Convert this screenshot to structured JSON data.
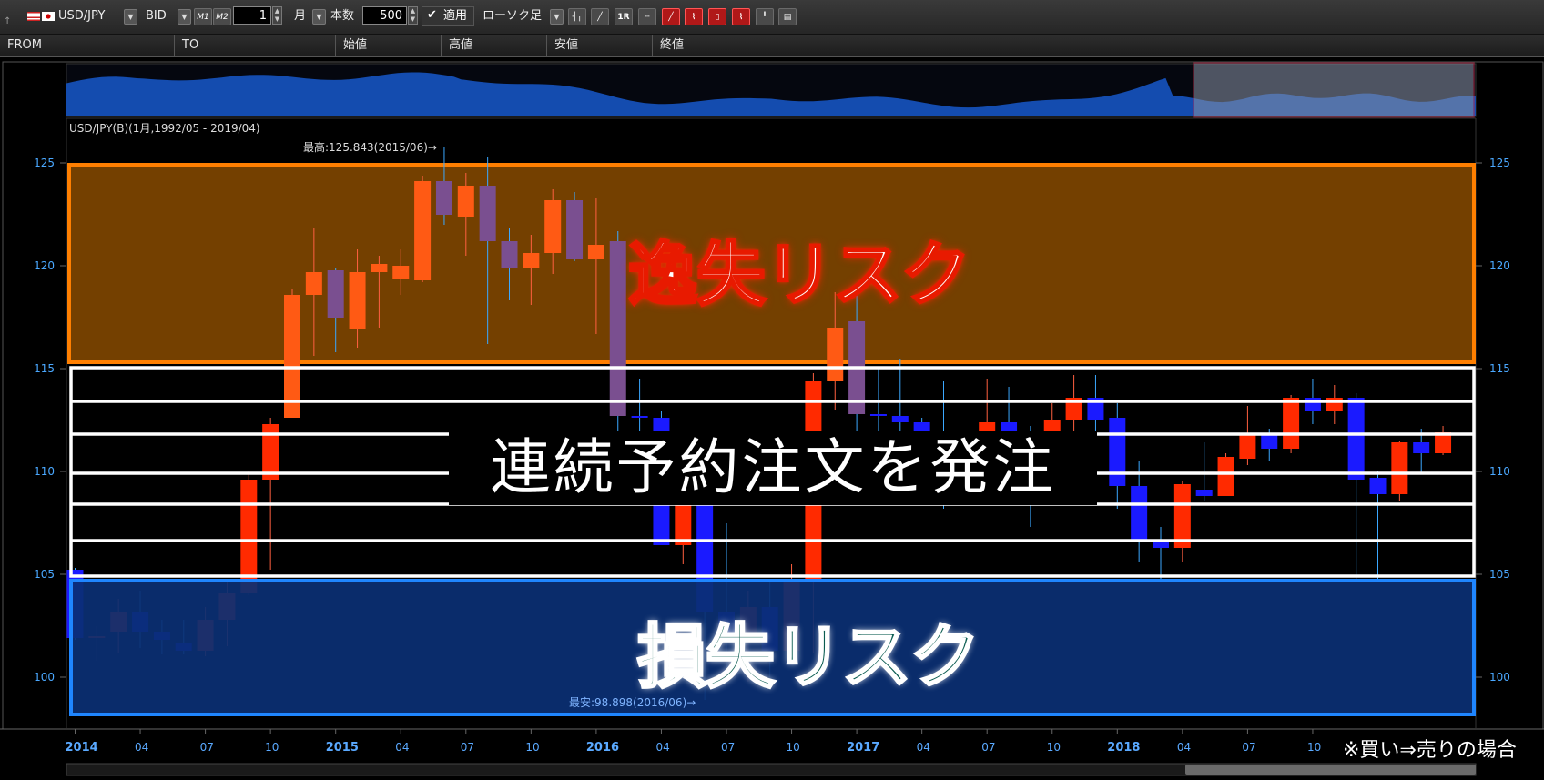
{
  "toolbar": {
    "symbol": "USD/JPY",
    "price_type": "BID",
    "m1": "M1",
    "m2": "M2",
    "period_value": "1",
    "period_unit": "月",
    "count_label": "本数",
    "count_value": "500",
    "apply_label": "適用",
    "chart_type": "ローソク足"
  },
  "columns": [
    "FROM",
    "TO",
    "始値",
    "高値",
    "安値",
    "終値"
  ],
  "chart": {
    "subtitle": "USD/JPY(B)(1月,1992/05 - 2019/04)",
    "high_label": "最高:125.843(2015/06)→",
    "low_label": "最安:98.898(2016/06)→",
    "y_ticks": [
      "100",
      "105",
      "110",
      "115",
      "120",
      "125"
    ],
    "x_labels": [
      {
        "t": "2014",
        "bold": true
      },
      {
        "t": "04"
      },
      {
        "t": "07"
      },
      {
        "t": "10"
      },
      {
        "t": "2015",
        "bold": true
      },
      {
        "t": "04"
      },
      {
        "t": "07"
      },
      {
        "t": "10"
      },
      {
        "t": "2016",
        "bold": true
      },
      {
        "t": "04"
      },
      {
        "t": "07"
      },
      {
        "t": "10"
      },
      {
        "t": "2017",
        "bold": true
      },
      {
        "t": "04"
      },
      {
        "t": "07"
      },
      {
        "t": "10"
      },
      {
        "t": "2018",
        "bold": true
      },
      {
        "t": "04"
      },
      {
        "t": "07"
      },
      {
        "t": "10"
      }
    ]
  },
  "chart_data": {
    "type": "candlestick",
    "ylim": [
      98,
      126
    ],
    "candles": [
      [
        105.2,
        105.3,
        101.8,
        101.9
      ],
      [
        101.9,
        102.5,
        100.8,
        102.0
      ],
      [
        102.2,
        103.8,
        101.2,
        103.2
      ],
      [
        103.2,
        104.2,
        101.4,
        102.2
      ],
      [
        102.2,
        102.8,
        101.1,
        101.8
      ],
      [
        101.7,
        102.8,
        101.1,
        101.3
      ],
      [
        101.3,
        103.4,
        101.0,
        102.8
      ],
      [
        102.8,
        104.8,
        101.5,
        104.1
      ],
      [
        104.1,
        110.0,
        104.0,
        109.6
      ],
      [
        109.6,
        112.6,
        105.2,
        112.3
      ],
      [
        112.6,
        118.9,
        112.6,
        118.6
      ],
      [
        118.6,
        121.8,
        115.6,
        119.7
      ],
      [
        119.8,
        119.9,
        115.8,
        117.5
      ],
      [
        116.9,
        120.8,
        116.0,
        119.7
      ],
      [
        119.7,
        120.5,
        117.0,
        120.1
      ],
      [
        119.4,
        120.8,
        118.6,
        120.0
      ],
      [
        119.3,
        124.4,
        119.2,
        124.1
      ],
      [
        124.1,
        125.8,
        122.0,
        122.5
      ],
      [
        122.4,
        124.5,
        120.5,
        123.9
      ],
      [
        123.9,
        125.3,
        116.2,
        121.2
      ],
      [
        121.2,
        121.8,
        118.3,
        119.9
      ],
      [
        119.9,
        121.5,
        118.1,
        120.6
      ],
      [
        120.6,
        123.7,
        119.6,
        123.2
      ],
      [
        123.2,
        123.6,
        120.2,
        120.3
      ],
      [
        120.3,
        123.3,
        116.7,
        121.0
      ],
      [
        121.2,
        121.7,
        111.0,
        112.7
      ],
      [
        112.7,
        114.5,
        110.9,
        112.6
      ],
      [
        112.6,
        112.9,
        107.6,
        106.4
      ],
      [
        106.4,
        111.5,
        105.5,
        110.7
      ],
      [
        110.7,
        110.8,
        98.9,
        103.2
      ],
      [
        103.2,
        107.5,
        99.9,
        102.1
      ],
      [
        102.1,
        104.2,
        99.8,
        103.4
      ],
      [
        103.4,
        104.7,
        100.0,
        101.3
      ],
      [
        101.3,
        105.5,
        101.2,
        104.8
      ],
      [
        104.8,
        114.8,
        101.2,
        114.4
      ],
      [
        114.4,
        118.7,
        113.0,
        117.0
      ],
      [
        117.3,
        118.6,
        111.6,
        112.8
      ],
      [
        112.8,
        115.0,
        111.6,
        112.7
      ],
      [
        112.7,
        115.5,
        110.1,
        112.4
      ],
      [
        112.4,
        112.6,
        108.4,
        111.3
      ],
      [
        111.4,
        114.4,
        108.2,
        110.8
      ],
      [
        110.8,
        111.6,
        108.8,
        110.9
      ],
      [
        110.9,
        114.5,
        110.7,
        112.4
      ],
      [
        112.4,
        114.1,
        110.2,
        110.3
      ],
      [
        110.3,
        112.2,
        107.3,
        109.9
      ],
      [
        109.9,
        113.3,
        108.8,
        112.5
      ],
      [
        112.5,
        114.7,
        112.0,
        113.6
      ],
      [
        113.6,
        114.7,
        111.9,
        112.5
      ],
      [
        112.6,
        113.3,
        108.2,
        109.3
      ],
      [
        109.3,
        110.5,
        105.6,
        106.7
      ],
      [
        106.7,
        107.3,
        104.6,
        106.3
      ],
      [
        106.3,
        109.5,
        105.6,
        109.4
      ],
      [
        109.1,
        111.4,
        108.6,
        108.8
      ],
      [
        108.8,
        110.9,
        108.8,
        110.7
      ],
      [
        110.6,
        113.2,
        110.3,
        111.8
      ],
      [
        111.8,
        112.1,
        110.5,
        111.1
      ],
      [
        111.1,
        113.7,
        110.9,
        113.6
      ],
      [
        113.6,
        114.5,
        112.3,
        112.9
      ],
      [
        112.9,
        114.2,
        112.3,
        113.6
      ],
      [
        113.6,
        113.8,
        104.6,
        109.6
      ],
      [
        109.7,
        110.0,
        104.8,
        108.9
      ],
      [
        108.9,
        111.5,
        108.6,
        111.4
      ],
      [
        111.4,
        112.1,
        109.9,
        110.9
      ],
      [
        110.9,
        112.2,
        110.8,
        111.9
      ]
    ]
  },
  "overlays": {
    "opportunity_risk": "逸失リスク",
    "loss_risk": "損失リスク",
    "order_text": "連続予約注文を発注",
    "footnote": "※買い⇒売りの場合"
  },
  "colors": {
    "up": "#ff2a00",
    "down": "#1a1aff",
    "accent": "#4aa8ff",
    "orange_zone": "#7a4300",
    "orange_border": "#ff7f00",
    "blue_zone": "#0b2f73",
    "blue_border": "#1f86ff"
  }
}
